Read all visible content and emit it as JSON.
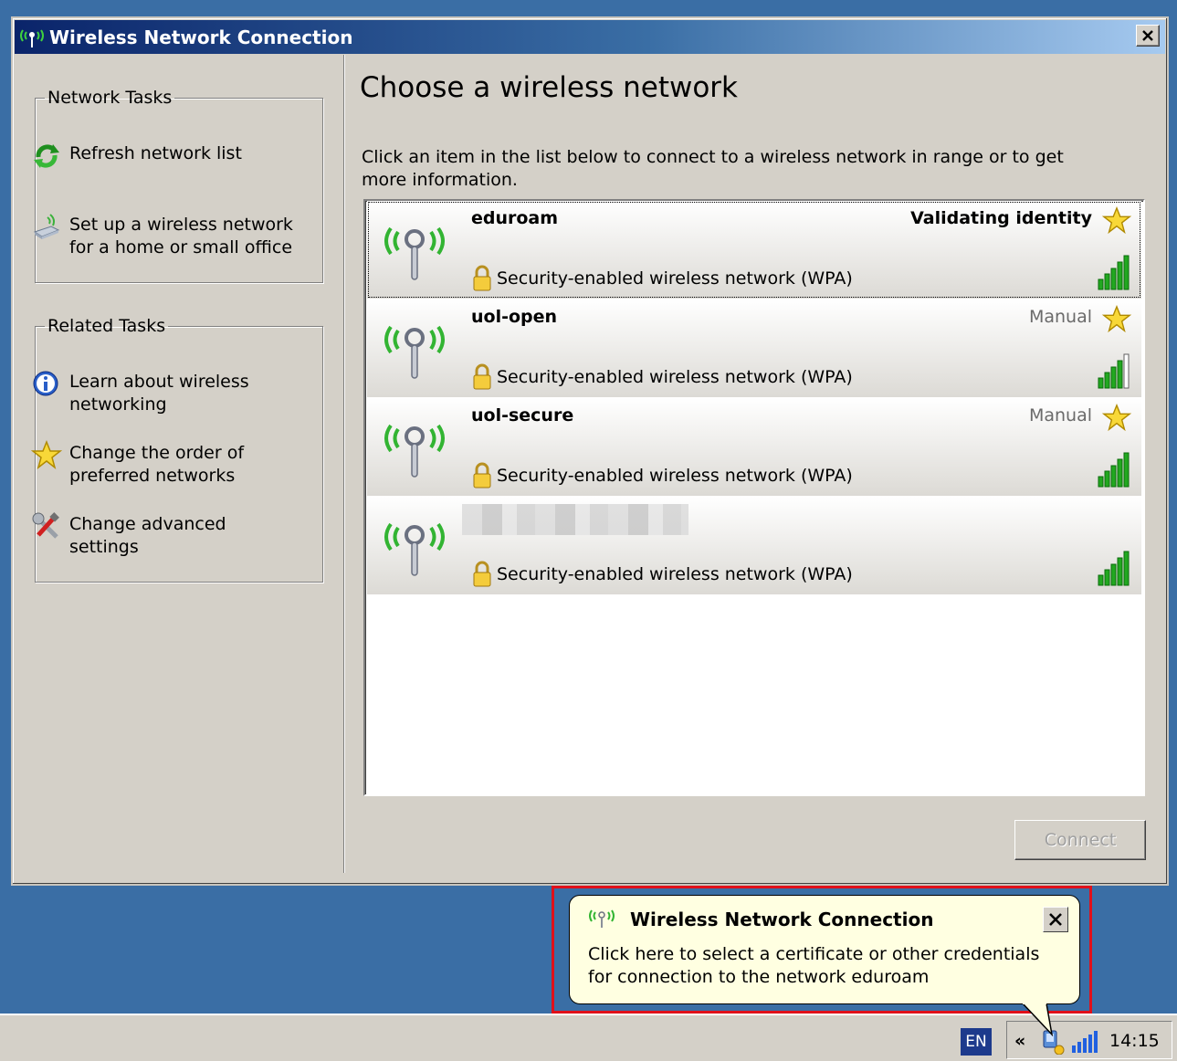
{
  "window": {
    "title": "Wireless Network Connection",
    "close_glyph": "✕"
  },
  "network_tasks": {
    "legend": "Network Tasks",
    "items": [
      {
        "label": "Refresh network list",
        "icon": "refresh-icon"
      },
      {
        "label": "Set up a wireless network for a home or small office",
        "icon": "wireless-setup-icon"
      }
    ]
  },
  "related_tasks": {
    "legend": "Related Tasks",
    "items": [
      {
        "label": "Learn about wireless networking",
        "icon": "info-icon"
      },
      {
        "label": "Change the order of preferred networks",
        "icon": "star-icon"
      },
      {
        "label": "Change advanced settings",
        "icon": "tools-icon"
      }
    ]
  },
  "main": {
    "heading": "Choose a wireless network",
    "instructions": "Click an item in the list below to connect to a wireless network in range or to get more information."
  },
  "networks": [
    {
      "name": "eduroam",
      "status": "Validating identity",
      "security": "Security-enabled wireless network (WPA)",
      "signal_bars": 5,
      "preferred": true,
      "selected": true
    },
    {
      "name": "uol-open",
      "status": "Manual",
      "security": "Security-enabled wireless network (WPA)",
      "signal_bars": 4,
      "preferred": true,
      "selected": false
    },
    {
      "name": "uol-secure",
      "status": "Manual",
      "security": "Security-enabled wireless network (WPA)",
      "signal_bars": 5,
      "preferred": true,
      "selected": false
    },
    {
      "name": "",
      "status": "",
      "security": "Security-enabled wireless network (WPA)",
      "signal_bars": 5,
      "preferred": false,
      "selected": false
    }
  ],
  "connect_label": "Connect",
  "taskbar": {
    "language": "EN",
    "chevron": "«",
    "clock": "14:15"
  },
  "balloon": {
    "title": "Wireless Network Connection",
    "text": "Click here to select a certificate or other credentials for connection to the network eduroam",
    "close_glyph": "✕"
  },
  "colors": {
    "desktop": "#3a6ea5",
    "titlebar_start": "#0a246a",
    "titlebar_end": "#a6caf0",
    "face": "#d4d0c8",
    "balloon_bg": "#ffffe1",
    "highlight": "#e0101a",
    "signal_green": "#22a820"
  }
}
